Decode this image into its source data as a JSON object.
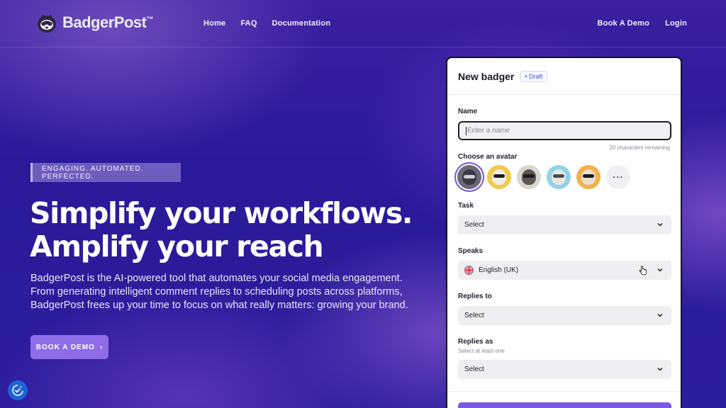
{
  "nav": {
    "logo_text": "BadgerPost",
    "logo_tm": "™",
    "links": [
      "Home",
      "FAQ",
      "Documentation"
    ],
    "right_links": [
      "Book A Demo",
      "Login"
    ]
  },
  "hero": {
    "tagline": "ENGAGING. AUTOMATED. PERFECTED.",
    "headline_line1": "Simplify your workflows.",
    "headline_line2": "Amplify your reach",
    "description": "BadgerPost is the AI-powered tool that automates your social media engagement. From generating intelligent comment replies to scheduling posts across platforms, BadgerPost frees up your time to focus on what really matters: growing your brand.",
    "cta_label": "BOOK A DEMO",
    "cta_arrow": "›"
  },
  "form": {
    "title": "New badger",
    "status_badge": "• Draft",
    "name_label": "Name",
    "name_placeholder": "Enter a name",
    "name_value": "",
    "characters_remaining": "20 characters remaining",
    "avatar_label": "Choose an avatar",
    "avatars": [
      "badger-1",
      "badger-2",
      "badger-3",
      "badger-4",
      "badger-5"
    ],
    "more_avatars": "···",
    "task_label": "Task",
    "task_value": "Select",
    "speaks_label": "Speaks",
    "speaks_value": "English (UK)",
    "replies_to_label": "Replies to",
    "replies_to_value": "Select",
    "replies_as_label": "Replies as",
    "replies_as_hint": "Select at least one",
    "replies_as_value": "Select"
  },
  "colors": {
    "accent": "#8f6ce8",
    "background": "#2c1d9c",
    "draft_text": "#3b59d6"
  },
  "icons": {
    "logo": "badger-logo-icon",
    "chevron": "chevron-down-icon",
    "flag": "uk-flag-icon",
    "cookie": "cookie-consent-icon"
  }
}
